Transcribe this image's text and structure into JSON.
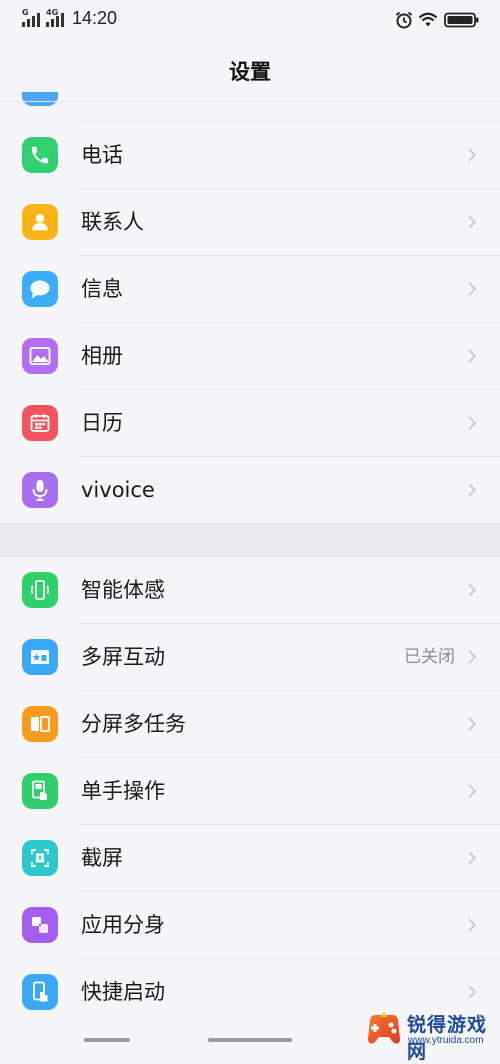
{
  "status_bar": {
    "network_1": "G",
    "network_2": "4G",
    "time": "14:20"
  },
  "header": {
    "title": "设置"
  },
  "group1": [
    {
      "label": "电话",
      "icon": "phone-icon",
      "color": "#33cf72"
    },
    {
      "label": "联系人",
      "icon": "contacts-icon",
      "color": "#f9b418"
    },
    {
      "label": "信息",
      "icon": "message-icon",
      "color": "#3baef7"
    },
    {
      "label": "相册",
      "icon": "gallery-icon",
      "color": "#b16ef0"
    },
    {
      "label": "日历",
      "icon": "calendar-icon",
      "color": "#f2535f"
    },
    {
      "label": "vivoice",
      "icon": "microphone-icon",
      "color": "#a86ef0"
    }
  ],
  "group2": [
    {
      "label": "智能体感",
      "icon": "smart-motion-icon",
      "color": "#2fcf6e"
    },
    {
      "label": "多屏互动",
      "icon": "multi-screen-icon",
      "color": "#3aa8f5",
      "value": "已关闭"
    },
    {
      "label": "分屏多任务",
      "icon": "split-screen-icon",
      "color": "#f99b1e"
    },
    {
      "label": "单手操作",
      "icon": "one-hand-icon",
      "color": "#2fcf6e"
    },
    {
      "label": "截屏",
      "icon": "screenshot-icon",
      "color": "#2ec7cb"
    },
    {
      "label": "应用分身",
      "icon": "app-clone-icon",
      "color": "#a35ef0"
    },
    {
      "label": "快捷启动",
      "icon": "quick-launch-icon",
      "color": "#3aa8f5"
    }
  ],
  "watermark": {
    "name": "锐得游戏网",
    "url": "www.ytruida.com"
  }
}
